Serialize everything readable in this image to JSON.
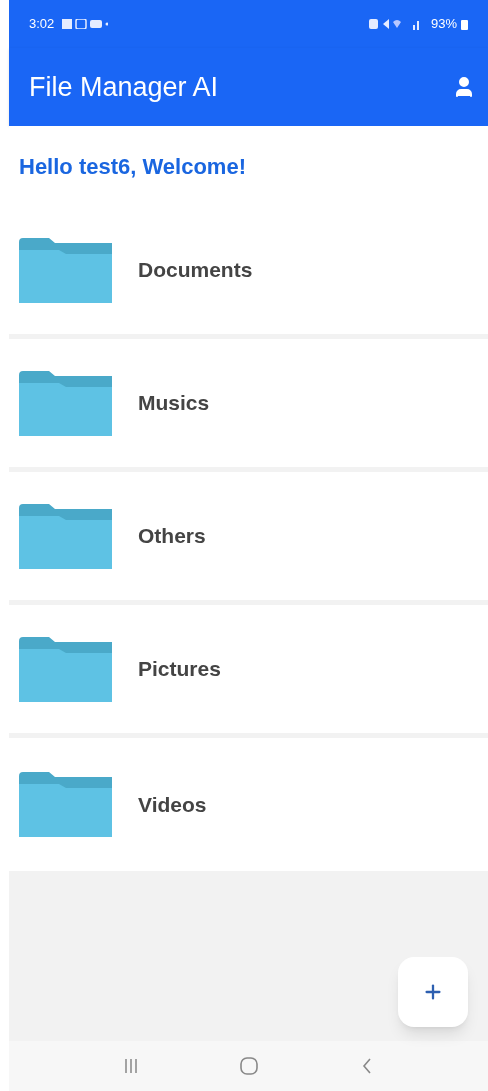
{
  "status_bar": {
    "time": "3:02",
    "battery": "93%"
  },
  "app_bar": {
    "title": "File Manager AI"
  },
  "greeting": "Hello test6, Welcome!",
  "folders": [
    {
      "name": "Documents"
    },
    {
      "name": "Musics"
    },
    {
      "name": "Others"
    },
    {
      "name": "Pictures"
    },
    {
      "name": "Videos"
    }
  ]
}
